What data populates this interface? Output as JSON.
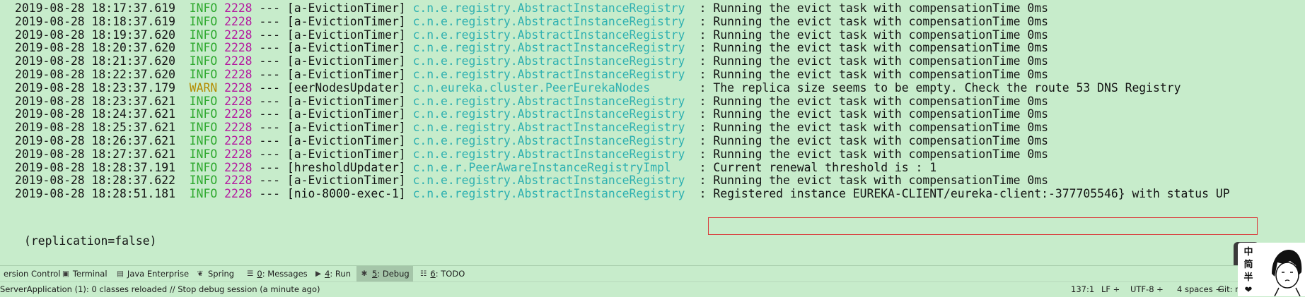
{
  "console": {
    "lines": [
      {
        "ts": "2019-08-28 18:17:37.619",
        "level": "INFO",
        "pid": "2228",
        "sep": "---",
        "thread": "[a-EvictionTimer]",
        "logger": "c.n.e.registry.AbstractInstanceRegistry",
        "message": ": Running the evict task with compensationTime 0ms"
      },
      {
        "ts": "2019-08-28 18:18:37.619",
        "level": "INFO",
        "pid": "2228",
        "sep": "---",
        "thread": "[a-EvictionTimer]",
        "logger": "c.n.e.registry.AbstractInstanceRegistry",
        "message": ": Running the evict task with compensationTime 0ms"
      },
      {
        "ts": "2019-08-28 18:19:37.620",
        "level": "INFO",
        "pid": "2228",
        "sep": "---",
        "thread": "[a-EvictionTimer]",
        "logger": "c.n.e.registry.AbstractInstanceRegistry",
        "message": ": Running the evict task with compensationTime 0ms"
      },
      {
        "ts": "2019-08-28 18:20:37.620",
        "level": "INFO",
        "pid": "2228",
        "sep": "---",
        "thread": "[a-EvictionTimer]",
        "logger": "c.n.e.registry.AbstractInstanceRegistry",
        "message": ": Running the evict task with compensationTime 0ms"
      },
      {
        "ts": "2019-08-28 18:21:37.620",
        "level": "INFO",
        "pid": "2228",
        "sep": "---",
        "thread": "[a-EvictionTimer]",
        "logger": "c.n.e.registry.AbstractInstanceRegistry",
        "message": ": Running the evict task with compensationTime 0ms"
      },
      {
        "ts": "2019-08-28 18:22:37.620",
        "level": "INFO",
        "pid": "2228",
        "sep": "---",
        "thread": "[a-EvictionTimer]",
        "logger": "c.n.e.registry.AbstractInstanceRegistry",
        "message": ": Running the evict task with compensationTime 0ms"
      },
      {
        "ts": "2019-08-28 18:23:37.179",
        "level": "WARN",
        "pid": "2228",
        "sep": "---",
        "thread": "[eerNodesUpdater]",
        "logger": "c.n.eureka.cluster.PeerEurekaNodes",
        "message": ": The replica size seems to be empty. Check the route 53 DNS Registry"
      },
      {
        "ts": "2019-08-28 18:23:37.621",
        "level": "INFO",
        "pid": "2228",
        "sep": "---",
        "thread": "[a-EvictionTimer]",
        "logger": "c.n.e.registry.AbstractInstanceRegistry",
        "message": ": Running the evict task with compensationTime 0ms"
      },
      {
        "ts": "2019-08-28 18:24:37.621",
        "level": "INFO",
        "pid": "2228",
        "sep": "---",
        "thread": "[a-EvictionTimer]",
        "logger": "c.n.e.registry.AbstractInstanceRegistry",
        "message": ": Running the evict task with compensationTime 0ms"
      },
      {
        "ts": "2019-08-28 18:25:37.621",
        "level": "INFO",
        "pid": "2228",
        "sep": "---",
        "thread": "[a-EvictionTimer]",
        "logger": "c.n.e.registry.AbstractInstanceRegistry",
        "message": ": Running the evict task with compensationTime 0ms"
      },
      {
        "ts": "2019-08-28 18:26:37.621",
        "level": "INFO",
        "pid": "2228",
        "sep": "---",
        "thread": "[a-EvictionTimer]",
        "logger": "c.n.e.registry.AbstractInstanceRegistry",
        "message": ": Running the evict task with compensationTime 0ms"
      },
      {
        "ts": "2019-08-28 18:27:37.621",
        "level": "INFO",
        "pid": "2228",
        "sep": "---",
        "thread": "[a-EvictionTimer]",
        "logger": "c.n.e.registry.AbstractInstanceRegistry",
        "message": ": Running the evict task with compensationTime 0ms"
      },
      {
        "ts": "2019-08-28 18:28:37.191",
        "level": "INFO",
        "pid": "2228",
        "sep": "---",
        "thread": "[hresholdUpdater]",
        "logger": "c.n.e.r.PeerAwareInstanceRegistryImpl",
        "message": ": Current renewal threshold is : 1"
      },
      {
        "ts": "2019-08-28 18:28:37.622",
        "level": "INFO",
        "pid": "2228",
        "sep": "---",
        "thread": "[a-EvictionTimer]",
        "logger": "c.n.e.registry.AbstractInstanceRegistry",
        "message": ": Running the evict task with compensationTime 0ms"
      },
      {
        "ts": "2019-08-28 18:28:51.181",
        "level": "INFO",
        "pid": "2228",
        "sep": "---",
        "thread": "[nio-8000-exec-1]",
        "logger": "c.n.e.registry.AbstractInstanceRegistry",
        "message": ": Registered instance EUREKA-CLIENT/eureka-client:-377705546} with status UP"
      }
    ],
    "wrap_continuation": "(replication=false)",
    "highlighted_line_index": 14
  },
  "colors": {
    "background": "#c7eccb",
    "info": "#2fa92f",
    "warn": "#b48c00",
    "pid": "#b4189f",
    "logger": "#2fb1b1",
    "highlight_border": "#d93a3a"
  },
  "toolwindows": [
    {
      "icon": "version-control-icon",
      "num": "",
      "label": "ersion Control",
      "active": false
    },
    {
      "icon": "terminal-icon",
      "num": "",
      "label": "Terminal",
      "active": false
    },
    {
      "icon": "java-enterprise-icon",
      "num": "",
      "label": "Java Enterprise",
      "active": false
    },
    {
      "icon": "spring-icon",
      "num": "",
      "label": "Spring",
      "active": false
    },
    {
      "icon": "messages-icon",
      "num": "0",
      "label": ": Messages",
      "active": false
    },
    {
      "icon": "run-icon",
      "num": "4",
      "label": ": Run",
      "active": false
    },
    {
      "icon": "debug-icon",
      "num": "5",
      "label": ": Debug",
      "active": true
    },
    {
      "icon": "todo-icon",
      "num": "6",
      "label": ": TODO",
      "active": false
    }
  ],
  "status": {
    "message": "ServerApplication (1): 0 classes reloaded // Stop debug session (a minute ago)",
    "position": "137:1",
    "line_separator": "LF ÷",
    "encoding": "UTF-8 ÷",
    "indent": "4 spaces ÷",
    "git": "Git: m"
  },
  "ime": {
    "chars": [
      "中",
      "简",
      "半",
      "❤"
    ]
  }
}
